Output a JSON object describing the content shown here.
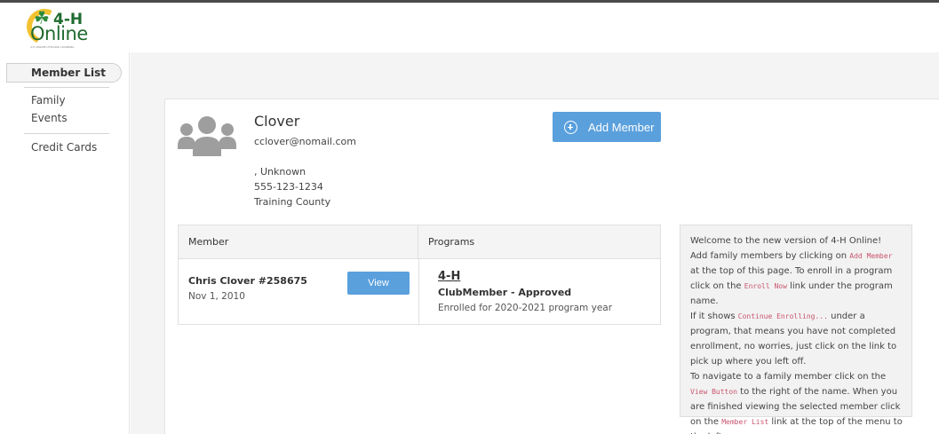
{
  "header": {
    "logo_clover": "☘",
    "logo_4h": "4-H",
    "logo_online": "Online",
    "logo_tagline": "4-H ONLINE LIFELONG LEARNING"
  },
  "sidebar": {
    "active_item": "Member List",
    "items": [
      "Family",
      "Events",
      "Credit Cards"
    ]
  },
  "profile": {
    "name": "Clover",
    "email": "cclover@nomail.com",
    "address": ", Unknown",
    "phone": "555-123-1234",
    "county": "Training County",
    "avatar_icon": "people-group-icon"
  },
  "actions": {
    "add_member_label": "Add Member",
    "add_member_icon": "plus-circle-icon"
  },
  "members_table": {
    "headers": [
      "Member",
      "Programs"
    ],
    "rows": [
      {
        "name": "Chris Clover #258675",
        "dob": "Nov 1, 2010",
        "view_label": "View",
        "program": "4-H",
        "status": "ClubMember - Approved",
        "enrollment": "Enrolled for 2020-2021 program year"
      }
    ]
  },
  "info_box": {
    "p1": "Welcome to the new version of 4-H Online!",
    "p2a": "Add family members by clicking on ",
    "p2code": "Add Member",
    "p2b": " at the top of this page. To enroll in a program click on the ",
    "p2code2": "Enroll Now",
    "p2c": " link under the program name.",
    "p3a": "If it shows ",
    "p3code": "Continue Enrolling...",
    "p3b": " under a program, that means you have not completed enrollment, no worries, just click on the link to pick up where you left off.",
    "p4a": "To navigate to a family member click on the ",
    "p4code": "View Button",
    "p4b": " to the right of the name. When you are finished viewing the selected member click on the ",
    "p4code2": "Member List",
    "p4c": " link at the top of the menu to the left."
  },
  "colors": {
    "primary_button": "#5aa0dd",
    "brand_green": "#1f6b2f",
    "brand_yellow": "#f2c230",
    "code_pink": "#c9556e"
  }
}
